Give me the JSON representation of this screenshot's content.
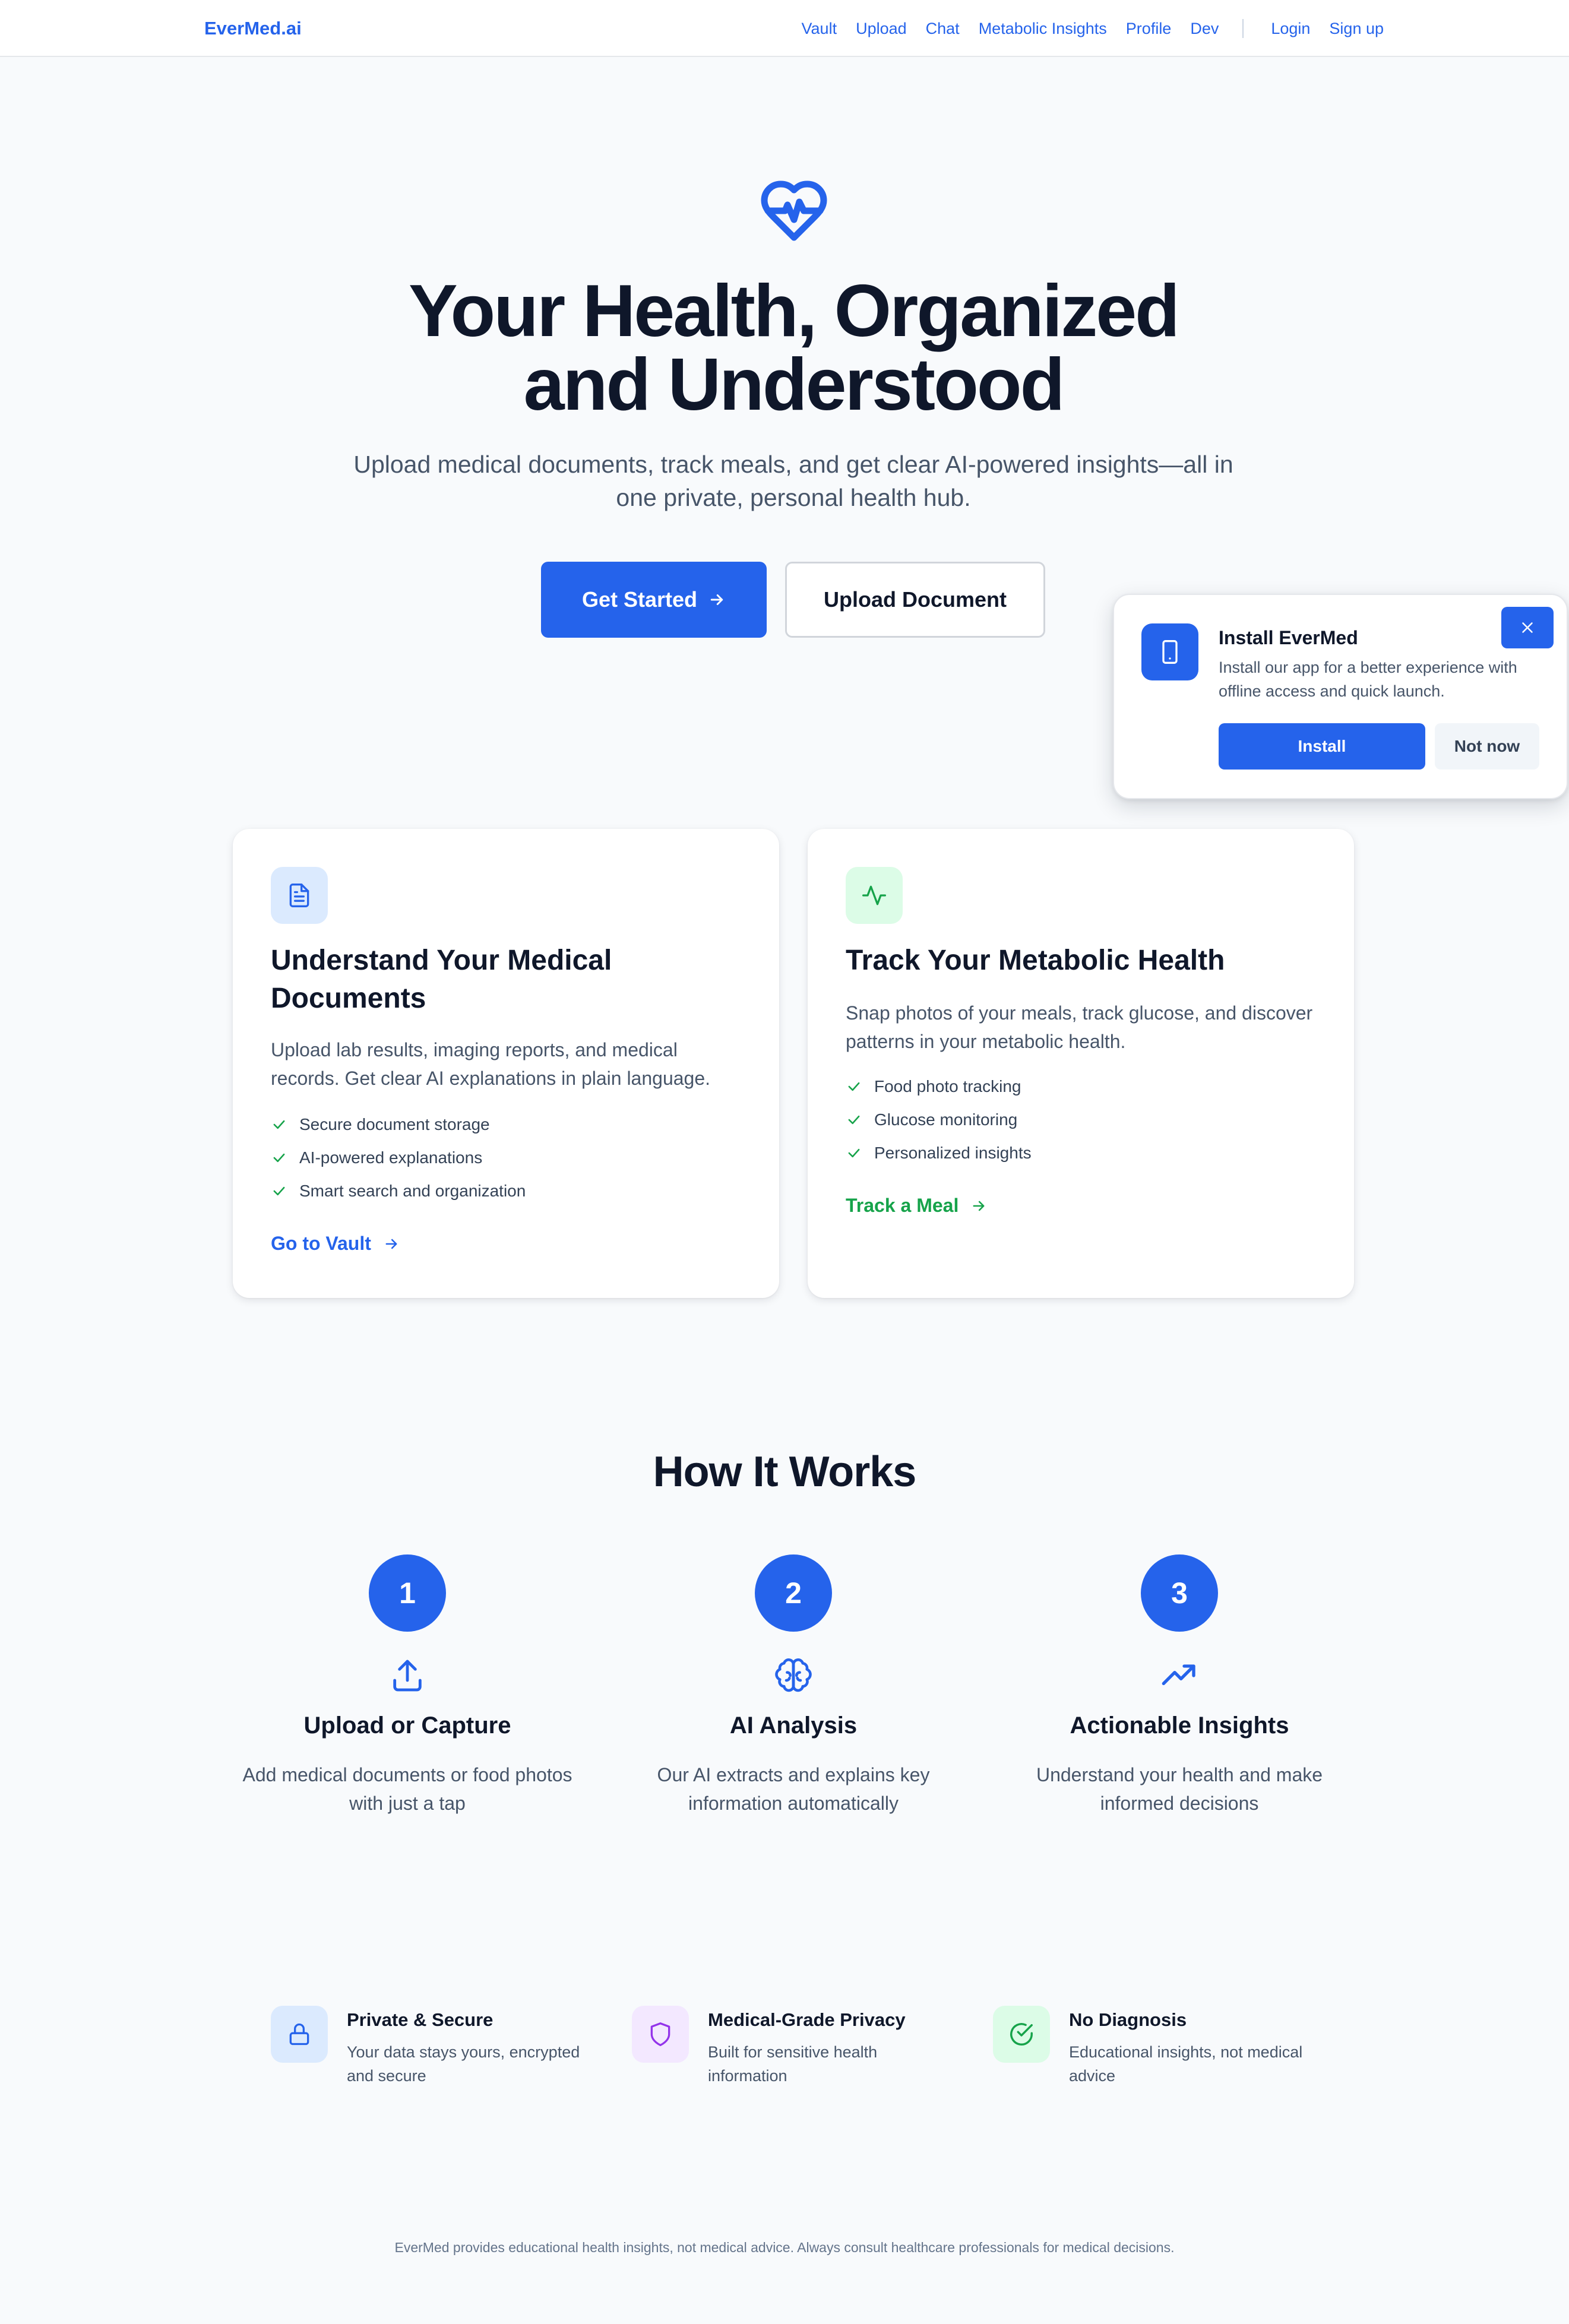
{
  "nav": {
    "brand": "EverMed.ai",
    "links": [
      "Vault",
      "Upload",
      "Chat",
      "Metabolic Insights",
      "Profile",
      "Dev"
    ],
    "auth": [
      "Login",
      "Sign up"
    ]
  },
  "hero": {
    "icon": "heart-pulse-icon",
    "title": "Your Health, Organized\nand Understood",
    "subtitle": "Upload medical documents, track meals, and get clear AI-powered insights—all in one private, personal health hub.",
    "primary_button": "Get Started",
    "secondary_button": "Upload Document"
  },
  "cards": [
    {
      "icon": "document-icon",
      "title": "Understand Your Medical Documents",
      "description": "Upload lab results, imaging reports, and medical records. Get clear AI explanations in plain language.",
      "features": [
        "Secure document storage",
        "AI-powered explanations",
        "Smart search and organization"
      ],
      "link": "Go to Vault"
    },
    {
      "icon": "activity-icon",
      "title": "Track Your Metabolic Health",
      "description": "Snap photos of your meals, track glucose, and discover patterns in your metabolic health.",
      "features": [
        "Food photo tracking",
        "Glucose monitoring",
        "Personalized insights"
      ],
      "link": "Track a Meal"
    }
  ],
  "how_it_works": {
    "title": "How It Works",
    "steps": [
      {
        "number": "1",
        "icon": "upload-icon",
        "title": "Upload or Capture",
        "description": "Add medical documents or food photos with just a tap"
      },
      {
        "number": "2",
        "icon": "brain-icon",
        "title": "AI Analysis",
        "description": "Our AI extracts and explains key information automatically"
      },
      {
        "number": "3",
        "icon": "trending-up-icon",
        "title": "Actionable Insights",
        "description": "Understand your health and make informed decisions"
      }
    ]
  },
  "trust": [
    {
      "icon": "lock-icon",
      "title": "Private & Secure",
      "description": "Your data stays yours, encrypted and secure"
    },
    {
      "icon": "shield-icon",
      "title": "Medical-Grade Privacy",
      "description": "Built for sensitive health information"
    },
    {
      "icon": "check-circle-icon",
      "title": "No Diagnosis",
      "description": "Educational insights, not medical advice"
    }
  ],
  "footer": {
    "disclaimer": "EverMed provides educational health insights, not medical advice. Always consult healthcare professionals for medical decisions."
  },
  "install_popup": {
    "icon": "smartphone-icon",
    "title": "Install EverMed",
    "description": "Install our app for a better experience with offline access and quick launch.",
    "install_button": "Install",
    "dismiss_button": "Not now",
    "close_icon": "close-icon"
  },
  "colors": {
    "primary": "#2563eb",
    "green": "#16a34a",
    "purple": "#9333ea",
    "text": "#0f172a",
    "muted": "#475569",
    "background": "#f8fafc"
  }
}
